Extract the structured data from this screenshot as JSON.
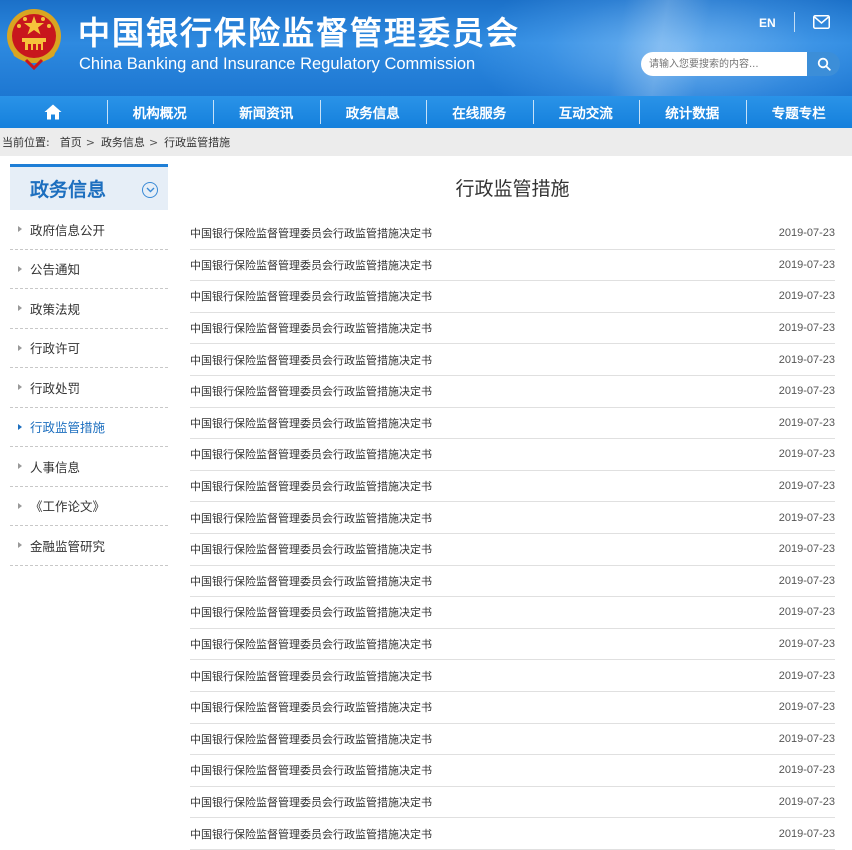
{
  "header": {
    "title_cn": "中国银行保险监督管理委员会",
    "title_en": "China Banking and Insurance Regulatory Commission",
    "lang_label": "EN",
    "search_placeholder": "请输入您要搜索的内容...",
    "mail_icon": "mail-icon",
    "search_icon": "search-icon",
    "emblem_icon": "national-emblem-icon"
  },
  "nav": {
    "home_icon": "home-icon",
    "items": [
      "机构概况",
      "新闻资讯",
      "政务信息",
      "在线服务",
      "互动交流",
      "统计数据",
      "专题专栏"
    ]
  },
  "breadcrumb": {
    "prefix": "当前位置:",
    "items": [
      "首页",
      "政务信息",
      "行政监管措施"
    ],
    "separator": ">"
  },
  "sidebar": {
    "title": "政务信息",
    "items": [
      {
        "label": "政府信息公开",
        "active": false
      },
      {
        "label": "公告通知",
        "active": false
      },
      {
        "label": "政策法规",
        "active": false
      },
      {
        "label": "行政许可",
        "active": false
      },
      {
        "label": "行政处罚",
        "active": false
      },
      {
        "label": "行政监管措施",
        "active": true
      },
      {
        "label": "人事信息",
        "active": false
      },
      {
        "label": "《工作论文》",
        "active": false
      },
      {
        "label": "金融监管研究",
        "active": false
      }
    ]
  },
  "main": {
    "title": "行政监管措施",
    "rows": [
      {
        "title": "中国银行保险监督管理委员会行政监管措施决定书",
        "date": "2019-07-23"
      },
      {
        "title": "中国银行保险监督管理委员会行政监管措施决定书",
        "date": "2019-07-23"
      },
      {
        "title": "中国银行保险监督管理委员会行政监管措施决定书",
        "date": "2019-07-23"
      },
      {
        "title": "中国银行保险监督管理委员会行政监管措施决定书",
        "date": "2019-07-23"
      },
      {
        "title": "中国银行保险监督管理委员会行政监管措施决定书",
        "date": "2019-07-23"
      },
      {
        "title": "中国银行保险监督管理委员会行政监管措施决定书",
        "date": "2019-07-23"
      },
      {
        "title": "中国银行保险监督管理委员会行政监管措施决定书",
        "date": "2019-07-23"
      },
      {
        "title": "中国银行保险监督管理委员会行政监管措施决定书",
        "date": "2019-07-23"
      },
      {
        "title": "中国银行保险监督管理委员会行政监管措施决定书",
        "date": "2019-07-23"
      },
      {
        "title": "中国银行保险监督管理委员会行政监管措施决定书",
        "date": "2019-07-23"
      },
      {
        "title": "中国银行保险监督管理委员会行政监管措施决定书",
        "date": "2019-07-23"
      },
      {
        "title": "中国银行保险监督管理委员会行政监管措施决定书",
        "date": "2019-07-23"
      },
      {
        "title": "中国银行保险监督管理委员会行政监管措施决定书",
        "date": "2019-07-23"
      },
      {
        "title": "中国银行保险监督管理委员会行政监管措施决定书",
        "date": "2019-07-23"
      },
      {
        "title": "中国银行保险监督管理委员会行政监管措施决定书",
        "date": "2019-07-23"
      },
      {
        "title": "中国银行保险监督管理委员会行政监管措施决定书",
        "date": "2019-07-23"
      },
      {
        "title": "中国银行保险监督管理委员会行政监管措施决定书",
        "date": "2019-07-23"
      },
      {
        "title": "中国银行保险监督管理委员会行政监管措施决定书",
        "date": "2019-07-23"
      },
      {
        "title": "中国银行保险监督管理委员会行政监管措施决定书",
        "date": "2019-07-23"
      },
      {
        "title": "中国银行保险监督管理委员会行政监管措施决定书",
        "date": "2019-07-23"
      }
    ]
  },
  "colors": {
    "header_blue": "#1f7ad3",
    "nav_blue": "#1a86de",
    "active_blue": "#1d6fbf",
    "breadcrumb_bg": "#ececec"
  }
}
